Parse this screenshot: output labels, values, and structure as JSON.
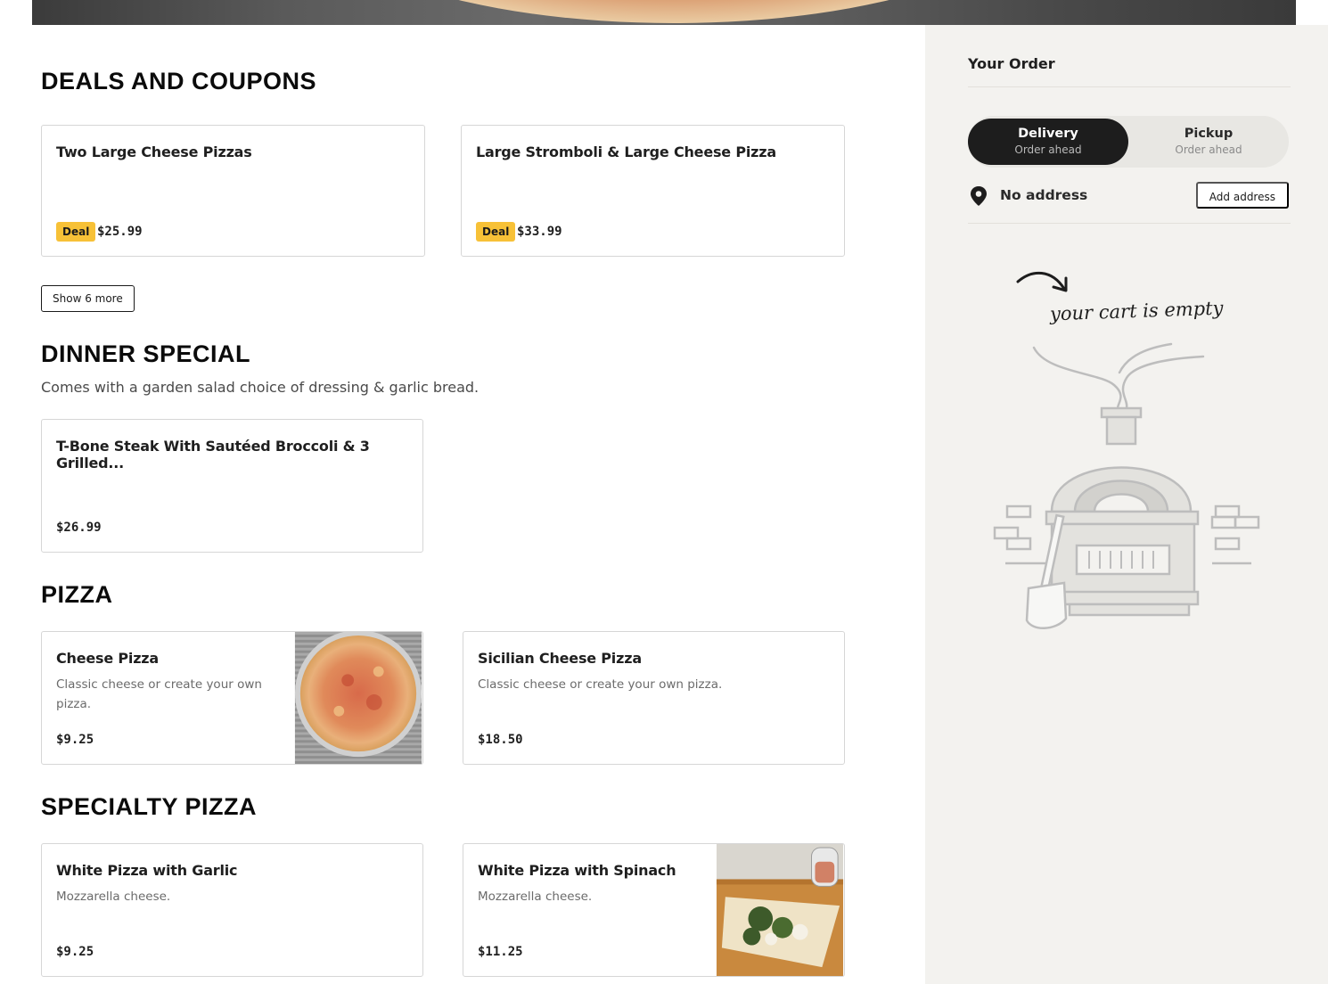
{
  "sections": {
    "deals": {
      "title": "DEALS AND COUPONS",
      "show_more_label": "Show 6 more",
      "items": [
        {
          "name": "Two Large Cheese Pizzas",
          "badge": "Deal",
          "price": "$25.99"
        },
        {
          "name": "Large Stromboli & Large Cheese Pizza",
          "badge": "Deal",
          "price": "$33.99"
        }
      ]
    },
    "dinner_special": {
      "title": "DINNER SPECIAL",
      "description": "Comes with a garden salad choice of dressing & garlic bread.",
      "items": [
        {
          "name": "T-Bone Steak With Sautéed Broccoli & 3 Grilled...",
          "price": "$26.99"
        }
      ]
    },
    "pizza": {
      "title": "PIZZA",
      "items": [
        {
          "name": "Cheese Pizza",
          "desc_line1": "Classic cheese or create your own",
          "desc_line2": "pizza.",
          "price": "$9.25"
        },
        {
          "name": "Sicilian Cheese Pizza",
          "desc_line1": "Classic cheese or create your own pizza.",
          "price": "$18.50"
        }
      ]
    },
    "specialty_pizza": {
      "title": "SPECIALTY PIZZA",
      "items": [
        {
          "name": "White Pizza with Garlic",
          "desc_line1": "Mozzarella cheese.",
          "price": "$9.25"
        },
        {
          "name": "White Pizza with Spinach",
          "desc_line1": "Mozzarella cheese.",
          "price": "$11.25"
        }
      ]
    }
  },
  "cart": {
    "title": "Your Order",
    "modes": [
      {
        "label": "Delivery",
        "sub": "Order ahead",
        "active": true
      },
      {
        "label": "Pickup",
        "sub": "Order ahead",
        "active": false
      }
    ],
    "address_text": "No address",
    "add_address_label": "Add address",
    "empty_caption": "your cart is empty"
  },
  "colors": {
    "deal_badge": "#f7c137",
    "sidebar_bg": "#f3f2ef",
    "toggle_active": "#1d1d1d"
  }
}
